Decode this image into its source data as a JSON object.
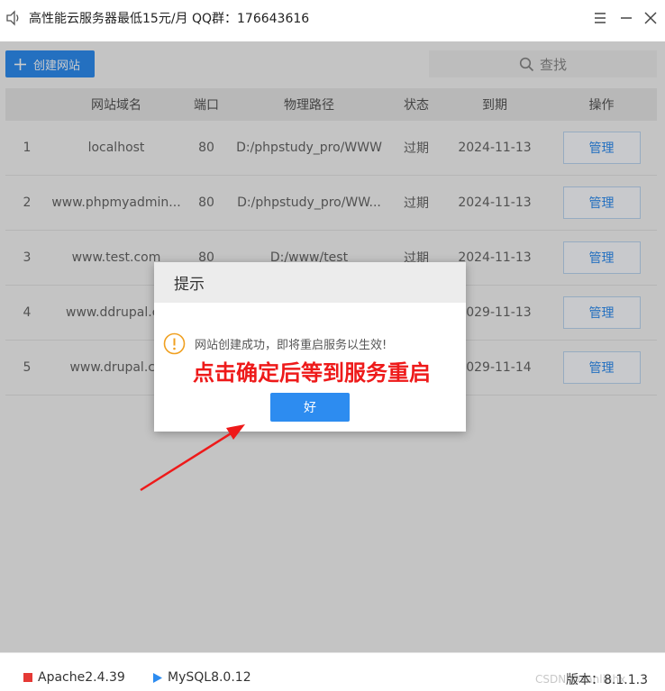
{
  "window": {
    "title": "高性能云服务器最低15元/月  QQ群：176643616"
  },
  "toolbar": {
    "create_label": "创建网站",
    "search_label": "查找"
  },
  "table": {
    "headers": [
      "",
      "网站域名",
      "端口",
      "物理路径",
      "状态",
      "到期",
      "操作"
    ],
    "rows": [
      {
        "idx": "1",
        "domain": "localhost",
        "port": "80",
        "path": "D:/phpstudy_pro/WWW",
        "status": "过期",
        "expiry": "2024-11-13",
        "action": "管理"
      },
      {
        "idx": "2",
        "domain": "www.phpmyadmin...",
        "port": "80",
        "path": "D:/phpstudy_pro/WW...",
        "status": "过期",
        "expiry": "2024-11-13",
        "action": "管理"
      },
      {
        "idx": "3",
        "domain": "www.test.com",
        "port": "80",
        "path": "D:/www/test",
        "status": "过期",
        "expiry": "2024-11-13",
        "action": "管理"
      },
      {
        "idx": "4",
        "domain": "www.ddrupal.co",
        "port": "",
        "path": "",
        "status": "",
        "expiry": "2029-11-13",
        "action": "管理"
      },
      {
        "idx": "5",
        "domain": "www.drupal.co",
        "port": "",
        "path": "",
        "status": "",
        "expiry": "2029-11-14",
        "action": "管理"
      }
    ]
  },
  "dialog": {
    "title": "提示",
    "message": "网站创建成功，即将重启服务以生效!",
    "ok_label": "好"
  },
  "annotation": {
    "text": "点击确定后等到服务重启",
    "color": "#ee1a1a"
  },
  "statusbar": {
    "apache": "Apache2.4.39",
    "mysql": "MySQL8.0.12",
    "version": "版本：8.1.1.3",
    "watermark": "CSDN @sanlinhx"
  },
  "colors": {
    "accent": "#2d8cf0",
    "stopped": "#e53935"
  }
}
